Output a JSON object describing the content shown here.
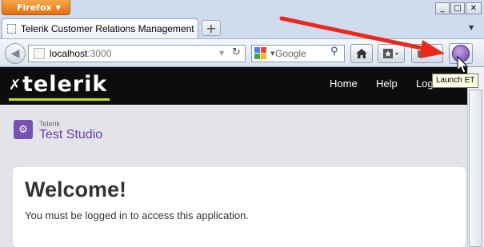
{
  "browser": {
    "menu_label": "Firefox",
    "window_controls": {
      "minimize": "_",
      "maximize": "□",
      "close": "✕"
    },
    "tab": {
      "title": "Telerik Customer Relations Management Sys..."
    },
    "new_tab": "+",
    "url": {
      "host": "localhost",
      "port": ":3000"
    },
    "search": {
      "placeholder": "Google"
    },
    "tooltip": "Launch ET",
    "icons": {
      "back": "back-arrow-icon",
      "reload": "reload-icon",
      "home": "home-icon",
      "bookmarks": "bookmarks-icon",
      "addon": "addon-icon",
      "launch_et": "launch-et-icon"
    }
  },
  "site": {
    "logo": "telerik",
    "nav": [
      "Home",
      "Help",
      "Log"
    ],
    "product_brand": "Telerik",
    "product_name": "Test Studio",
    "welcome_title": "Welcome!",
    "welcome_message": "You must be logged in to access this application."
  },
  "colors": {
    "accent_green": "#c8e11d",
    "product_purple": "#6a3aa8",
    "arrow_red": "#e8291c",
    "firefox_orange": "#e56f0e"
  }
}
